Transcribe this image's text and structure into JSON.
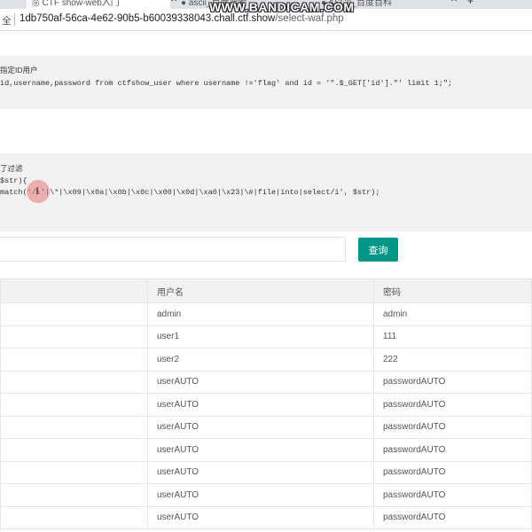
{
  "browser": {
    "tabs": [
      {
        "label": "CTF show-web入门"
      },
      {
        "label": "ascii_百度搜索"
      },
      {
        "label": "ASCII_百度百科"
      }
    ],
    "watermark": "WWW.BANDICAM.COM",
    "security_label": "全",
    "url_host": "1db750af-56ca-4e62-90b5-b60039338043.chall.ctf.show",
    "url_path": "/select-waf.php"
  },
  "section1": {
    "title": "指定ID用户",
    "code": "id,username,password from ctfshow_user where username !='flag' and id = '\".$_GET['id'].\"' limit 1;\";"
  },
  "section2": {
    "title": "了过滤",
    "line1": "$str){",
    "line2": "match('/\\'|\\*|\\x09|\\x0a|\\x0b|\\x0c|\\x00|\\x0d|\\xa0|\\x23|\\#|file|into|select/i', $str);"
  },
  "form": {
    "input_value": "",
    "query_label": "查询"
  },
  "table": {
    "headers": [
      "",
      "用户名",
      "密码"
    ],
    "rows": [
      [
        "",
        "admin",
        "admin"
      ],
      [
        "",
        "user1",
        "111"
      ],
      [
        "",
        "user2",
        "222"
      ],
      [
        "",
        "userAUTO",
        "passwordAUTO"
      ],
      [
        "",
        "userAUTO",
        "passwordAUTO"
      ],
      [
        "",
        "userAUTO",
        "passwordAUTO"
      ],
      [
        "",
        "userAUTO",
        "passwordAUTO"
      ],
      [
        "",
        "userAUTO",
        "passwordAUTO"
      ],
      [
        "",
        "userAUTO",
        "passwordAUTO"
      ],
      [
        "",
        "userAUTO",
        "passwordAUTO"
      ]
    ]
  }
}
